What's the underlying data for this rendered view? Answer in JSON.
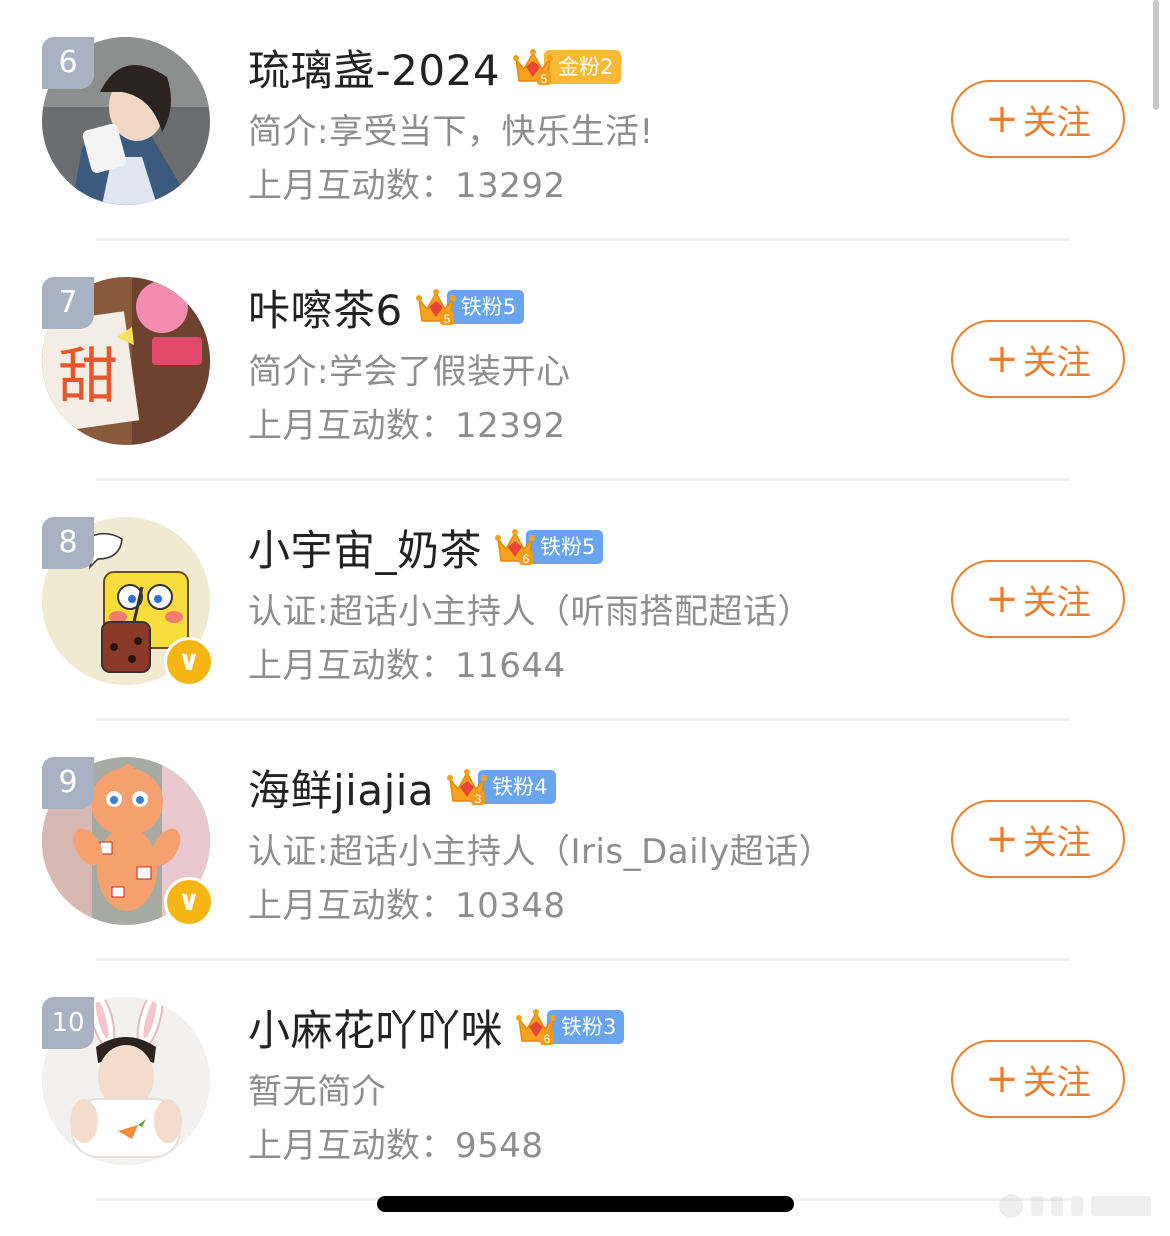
{
  "rows": [
    {
      "rank": "6",
      "name": "琉璃盏-2024",
      "badge_level": "5",
      "badge_label": "金粉2",
      "badge_type": "gold",
      "desc": "简介:享受当下，快乐生活!",
      "count_text": "上月互动数：13292",
      "follow_label": "关注",
      "follow_plus": "+",
      "verified": false,
      "avatar_icon": "woman-photo-avatar"
    },
    {
      "rank": "7",
      "name": "咔嚓茶6",
      "badge_level": "5",
      "badge_label": "铁粉5",
      "badge_type": "iron",
      "desc": "简介:学会了假装开心",
      "count_text": "上月互动数：12392",
      "follow_label": "关注",
      "follow_plus": "+",
      "verified": false,
      "avatar_icon": "sweet-sign-avatar"
    },
    {
      "rank": "8",
      "name": "小宇宙_奶茶",
      "badge_level": "6",
      "badge_label": "铁粉5",
      "badge_type": "iron",
      "desc": "认证:超话小主持人（听雨搭配超话）",
      "count_text": "上月互动数：11644",
      "follow_label": "关注",
      "follow_plus": "+",
      "verified": true,
      "avatar_icon": "spongebob-milktea-avatar"
    },
    {
      "rank": "9",
      "name": "海鲜jiajia",
      "badge_level": "3",
      "badge_label": "铁粉4",
      "badge_type": "iron",
      "desc": "认证:超话小主持人（Iris_Daily超话）",
      "count_text": "上月互动数：10348",
      "follow_label": "关注",
      "follow_plus": "+",
      "verified": true,
      "avatar_icon": "doll-avatar"
    },
    {
      "rank": "10",
      "name": "小麻花吖吖咪",
      "badge_level": "6",
      "badge_label": "铁粉3",
      "badge_type": "iron",
      "desc": "暂无简介",
      "count_text": "上月互动数：9548",
      "follow_label": "关注",
      "follow_plus": "+",
      "verified": true,
      "verified_hidden": true,
      "avatar_icon": "bunny-ears-avatar"
    }
  ],
  "colors": {
    "accent_orange": "#f07d2b",
    "badge_gold": "#f9b936",
    "badge_iron": "#69a5ee",
    "rank_bg": "#a9b2c3",
    "verified": "#f5b614"
  }
}
